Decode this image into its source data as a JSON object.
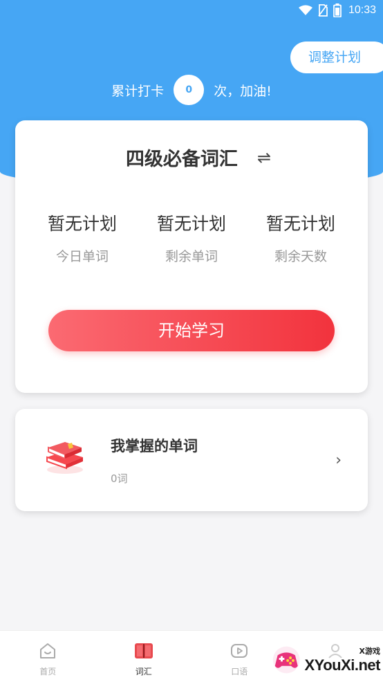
{
  "status_bar": {
    "time": "10:33"
  },
  "header": {
    "adjust_plan_label": "调整计划",
    "checkin_prefix": "累计打卡",
    "checkin_count": "0",
    "checkin_suffix": "次，加油!"
  },
  "plan_card": {
    "book_title": "四级必备词汇",
    "swap_symbol": "⇌",
    "stats": [
      {
        "value": "暂无计划",
        "label": "今日单词"
      },
      {
        "value": "暂无计划",
        "label": "剩余单词"
      },
      {
        "value": "暂无计划",
        "label": "剩余天数"
      }
    ],
    "start_button_label": "开始学习"
  },
  "words_card": {
    "title": "我掌握的单词",
    "count": "0词",
    "chevron": "›"
  },
  "tabbar": {
    "tabs": [
      {
        "label": "首页",
        "icon": "home-icon",
        "active": false
      },
      {
        "label": "词汇",
        "icon": "book-icon",
        "active": true
      },
      {
        "label": "口语",
        "icon": "play-icon",
        "active": false
      },
      {
        "label": "",
        "icon": "profile-icon",
        "active": false
      }
    ]
  },
  "watermark": {
    "small": "X游戏",
    "big": "XYouXi.net"
  },
  "colors": {
    "primary": "#46a6f4",
    "accent_red": "#f2333d",
    "background": "#f5f5f7"
  }
}
